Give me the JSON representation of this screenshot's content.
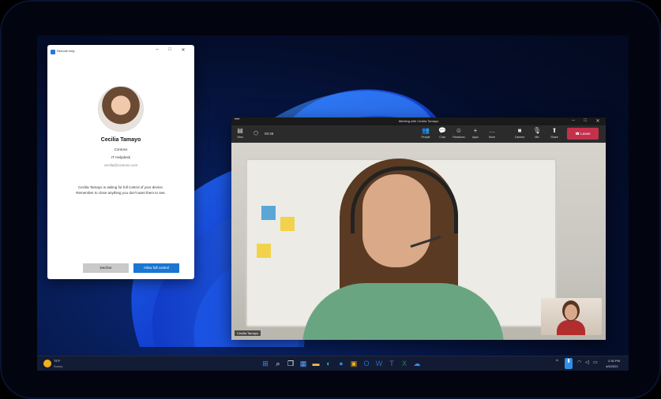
{
  "remote_help": {
    "title": "Remote help",
    "minimize": "–",
    "maximize": "□",
    "close": "✕",
    "name": "Cecilia Tamayo",
    "company": "Contoso",
    "department": "IT Helpdesk",
    "email": "cecilia@contoso.com",
    "message_line1": "Cecilia Tamayo is asking for full control of your device.",
    "message_line2": "Remember to close anything you don't want them to see.",
    "decline": "Decline",
    "allow": "Allow full control"
  },
  "teams": {
    "title": "Meeting with Cecilia Tamayo",
    "dots": "•••",
    "minimize": "–",
    "maximize": "□",
    "close": "✕",
    "view_label": "View",
    "timer": "00:48",
    "toolbar": [
      {
        "icon": "people-icon",
        "glyph": "👥",
        "label": "People"
      },
      {
        "icon": "chat-icon",
        "glyph": "💬",
        "label": "Chat"
      },
      {
        "icon": "reactions-icon",
        "glyph": "☺",
        "label": "Reactions"
      },
      {
        "icon": "apps-icon",
        "glyph": "+",
        "label": "Apps"
      },
      {
        "icon": "more-icon",
        "glyph": "…",
        "label": "More"
      },
      {
        "icon": "camera-icon",
        "glyph": "■",
        "label": "Camera"
      },
      {
        "icon": "mic-icon",
        "glyph": "🎙",
        "label": "Mic"
      },
      {
        "icon": "share-icon",
        "glyph": "⬆",
        "label": "Share"
      }
    ],
    "leave": "Leave",
    "participant_name": "Cecilia Tamayo"
  },
  "taskbar": {
    "weather_temp": "75°F",
    "weather_cond": "Sunny",
    "time": "2:30 PM",
    "date": "4/5/2022",
    "apps": [
      {
        "icon": "start-icon",
        "glyph": "⊞",
        "color": "#3b8ff0"
      },
      {
        "icon": "search-icon",
        "glyph": "⌕",
        "color": "#ffffff"
      },
      {
        "icon": "task-view-icon",
        "glyph": "❐",
        "color": "#ffffff"
      },
      {
        "icon": "widgets-icon",
        "glyph": "▦",
        "color": "#5aa0ff"
      },
      {
        "icon": "file-explorer-icon",
        "glyph": "▬",
        "color": "#f2c14e"
      },
      {
        "icon": "edge-icon",
        "glyph": "◐",
        "color": "#2fb3b5"
      },
      {
        "icon": "edge-browser-icon",
        "glyph": "●",
        "color": "#1f8ae0"
      },
      {
        "icon": "store-icon",
        "glyph": "▣",
        "color": "#f0b020"
      },
      {
        "icon": "outlook-icon",
        "glyph": "O",
        "color": "#1e6fd6"
      },
      {
        "icon": "word-icon",
        "glyph": "W",
        "color": "#2b65c8"
      },
      {
        "icon": "teams-icon",
        "glyph": "T",
        "color": "#6264a7"
      },
      {
        "icon": "excel-icon",
        "glyph": "X",
        "color": "#1f8a4c"
      },
      {
        "icon": "remote-help-icon",
        "glyph": "☁",
        "color": "#2f8fe8"
      }
    ],
    "tray_chevron": "^",
    "tray_remote": "▮",
    "tray_wifi": "◠",
    "tray_volume": "◁",
    "tray_battery": "▭"
  }
}
